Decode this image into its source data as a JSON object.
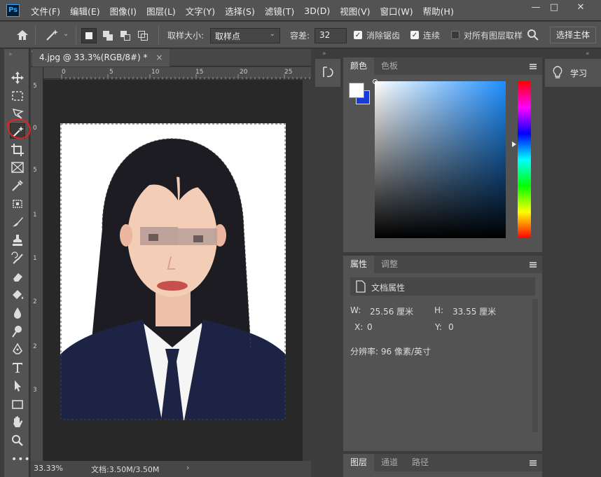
{
  "app": {
    "logo": "Ps"
  },
  "menu": [
    "文件(F)",
    "编辑(E)",
    "图像(I)",
    "图层(L)",
    "文字(Y)",
    "选择(S)",
    "滤镜(T)",
    "3D(D)",
    "视图(V)",
    "窗口(W)",
    "帮助(H)"
  ],
  "window_buttons": {
    "minimize": "—",
    "maximize": "□",
    "close": "✕"
  },
  "options": {
    "sample_size_label": "取样大小:",
    "sample_size_value": "取样点",
    "tolerance_label": "容差:",
    "tolerance_value": "32",
    "anti_alias_label": "消除锯齿",
    "contiguous_label": "连续",
    "sample_all_label": "对所有图层取样",
    "select_subject": "选择主体",
    "anti_alias_checked": true,
    "contiguous_checked": true,
    "sample_all_checked": false
  },
  "document": {
    "tab_title": "4.jpg @ 33.3%(RGB/8#) *",
    "tab_close": "×",
    "zoom": "33.33%",
    "doc_size": "文档:3.50M/3.50M",
    "status_arrow": "›"
  },
  "ruler": {
    "h": [
      "0",
      "5",
      "10",
      "15",
      "20",
      "25"
    ],
    "v": [
      "5",
      "0",
      "5",
      "1",
      "1",
      "2",
      "2",
      "3"
    ]
  },
  "panels": {
    "color_tabs": [
      "颜色",
      "色板"
    ],
    "props_tabs": [
      "属性",
      "调整"
    ],
    "doc_props_title": "文档属性",
    "width_label": "W:",
    "width_value": "25.56 厘米",
    "height_label": "H:",
    "height_value": "33.55 厘米",
    "x_label": "X:",
    "x_value": "0",
    "y_label": "Y:",
    "y_value": "0",
    "resolution": "分辨率: 96 像素/英寸",
    "layers_tabs": [
      "图层",
      "通道",
      "路径"
    ],
    "learn": "学习"
  },
  "colors": {
    "fg": "#ffffff",
    "bg": "#1a3ad9",
    "accent": "#31a8ff",
    "annotation": "#e32222"
  }
}
